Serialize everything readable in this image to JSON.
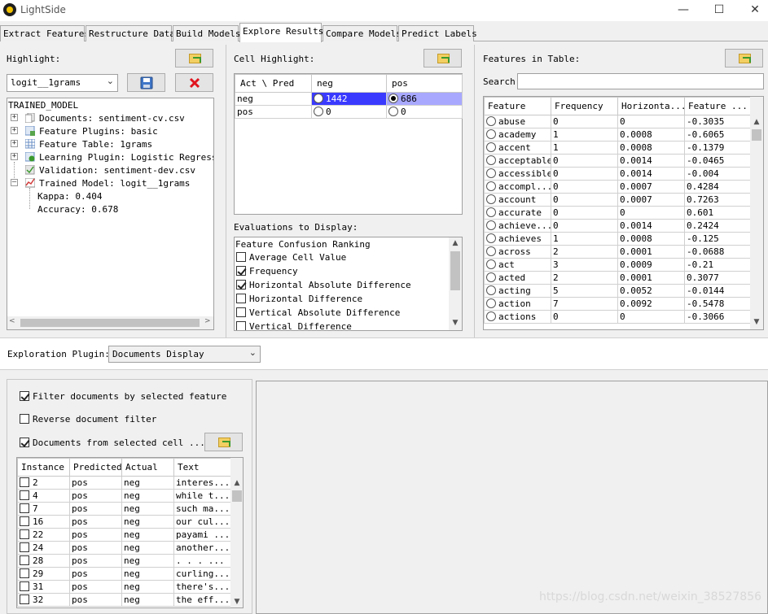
{
  "window": {
    "title": "LightSide"
  },
  "tabs": [
    {
      "label": "Extract Features"
    },
    {
      "label": "Restructure Data"
    },
    {
      "label": "Build Models"
    },
    {
      "label": "Explore Results"
    },
    {
      "label": "Compare Models"
    },
    {
      "label": "Predict Labels"
    }
  ],
  "highlight": {
    "label": "Highlight:",
    "selected_model": "logit__1grams",
    "tree": {
      "root": "TRAINED_MODEL",
      "nodes": [
        {
          "label": "Documents: sentiment-cv.csv",
          "icon": "documents-icon"
        },
        {
          "label": "Feature Plugins: basic",
          "icon": "plugin-icon"
        },
        {
          "label": "Feature Table: 1grams",
          "icon": "table-icon"
        },
        {
          "label": "Learning Plugin:  Logistic Regressio",
          "icon": "learning-icon"
        },
        {
          "label": "Validation: sentiment-dev.csv",
          "icon": "validation-icon"
        },
        {
          "label": "Trained Model: logit__1grams",
          "icon": "model-icon"
        }
      ],
      "metrics": [
        {
          "label": "Kappa: 0.404"
        },
        {
          "label": "Accuracy: 0.678"
        }
      ]
    }
  },
  "cell_highlight": {
    "label": "Cell Highlight:",
    "headers": [
      "Act \\ Pred",
      "neg",
      "pos"
    ],
    "rows": [
      {
        "act": "neg",
        "neg": "1442",
        "pos": "686"
      },
      {
        "act": "pos",
        "neg": "0",
        "pos": "0"
      }
    ],
    "selection_color": "#3a3aff"
  },
  "evaluations": {
    "label": "Evaluations to Display:",
    "items": [
      {
        "label": "Feature Confusion Ranking",
        "checkbox": false,
        "checked": false
      },
      {
        "label": "Average Cell Value",
        "checkbox": true,
        "checked": false
      },
      {
        "label": "Frequency",
        "checkbox": true,
        "checked": true
      },
      {
        "label": "Horizontal Absolute Difference",
        "checkbox": true,
        "checked": true
      },
      {
        "label": "Horizontal Difference",
        "checkbox": true,
        "checked": false
      },
      {
        "label": "Vertical Absolute Difference",
        "checkbox": true,
        "checked": false
      },
      {
        "label": "Vertical Difference",
        "checkbox": true,
        "checked": false
      }
    ]
  },
  "features": {
    "label": "Features in Table:",
    "search_label": "Search:",
    "search_value": "",
    "headers": [
      "Feature",
      "Frequency",
      "Horizonta...",
      "Feature ..."
    ],
    "rows": [
      [
        "abuse",
        "0",
        "0",
        "-0.3035"
      ],
      [
        "academy",
        "1",
        "0.0008",
        "-0.6065"
      ],
      [
        "accent",
        "1",
        "0.0008",
        "-0.1379"
      ],
      [
        "acceptable",
        "0",
        "0.0014",
        "-0.0465"
      ],
      [
        "accessible",
        "0",
        "0.0014",
        "-0.004"
      ],
      [
        "accompl...",
        "0",
        "0.0007",
        "0.4284"
      ],
      [
        "account",
        "0",
        "0.0007",
        "0.7263"
      ],
      [
        "accurate",
        "0",
        "0",
        "0.601"
      ],
      [
        "achieve...",
        "0",
        "0.0014",
        "0.2424"
      ],
      [
        "achieves",
        "1",
        "0.0008",
        "-0.125"
      ],
      [
        "across",
        "2",
        "0.0001",
        "-0.0688"
      ],
      [
        "act",
        "3",
        "0.0009",
        "-0.21"
      ],
      [
        "acted",
        "2",
        "0.0001",
        "0.3077"
      ],
      [
        "acting",
        "5",
        "0.0052",
        "-0.0144"
      ],
      [
        "action",
        "7",
        "0.0092",
        "-0.5478"
      ],
      [
        "actions",
        "0",
        "0",
        "-0.3066"
      ]
    ]
  },
  "exploration": {
    "label": "Exploration Plugin:",
    "selected": "Documents Display"
  },
  "documents": {
    "filter_label": "Filter documents by selected feature",
    "filter_checked": true,
    "reverse_label": "Reverse document filter",
    "reverse_checked": false,
    "from_cell_label": "Documents from selected cell ...",
    "from_cell_checked": true,
    "headers": [
      "Instance",
      "Predicted",
      "Actual",
      "Text"
    ],
    "rows": [
      [
        "2",
        "pos",
        "neg",
        "interes..."
      ],
      [
        "4",
        "pos",
        "neg",
        "while t..."
      ],
      [
        "7",
        "pos",
        "neg",
        "such ma..."
      ],
      [
        "16",
        "pos",
        "neg",
        "our cul..."
      ],
      [
        "22",
        "pos",
        "neg",
        "payami ..."
      ],
      [
        "24",
        "pos",
        "neg",
        "another..."
      ],
      [
        "28",
        "pos",
        "neg",
        ". . . ..."
      ],
      [
        "29",
        "pos",
        "neg",
        "curling..."
      ],
      [
        "31",
        "pos",
        "neg",
        "there's..."
      ],
      [
        "32",
        "pos",
        "neg",
        "the eff..."
      ]
    ]
  },
  "watermark": "https://blog.csdn.net/weixin_38527856"
}
